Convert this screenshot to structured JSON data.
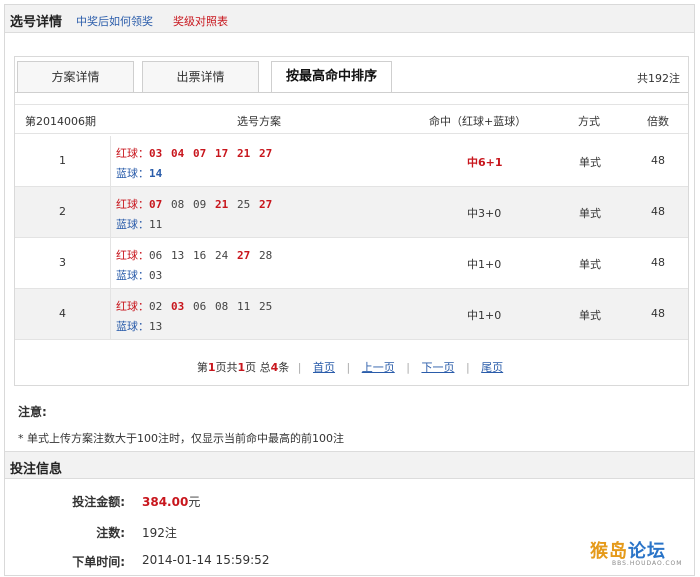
{
  "header": {
    "title": "选号详情",
    "link1": "中奖后如何领奖",
    "link2": "奖级对照表"
  },
  "tabs": [
    {
      "label": "方案详情"
    },
    {
      "label": "出票详情"
    },
    {
      "label": "按最高命中排序"
    }
  ],
  "total": "共192注",
  "table": {
    "headers": [
      "第2014006期",
      "选号方案",
      "命中（红球+蓝球）",
      "方式",
      "倍数"
    ],
    "red_label": "红球：",
    "blue_label": "蓝球：",
    "rows": [
      {
        "idx": "1",
        "red": [
          "03",
          "04",
          "07",
          "17",
          "21",
          "27"
        ],
        "red_hit": [
          true,
          true,
          true,
          true,
          true,
          true
        ],
        "blue": [
          "14"
        ],
        "blue_hit": [
          true
        ],
        "hit": "中6+1",
        "hit_main": true,
        "mode": "单式",
        "times": "48"
      },
      {
        "idx": "2",
        "red": [
          "07",
          "08",
          "09",
          "21",
          "25",
          "27"
        ],
        "red_hit": [
          true,
          false,
          false,
          true,
          false,
          true
        ],
        "blue": [
          "11"
        ],
        "blue_hit": [
          false
        ],
        "hit": "中3+0",
        "hit_main": false,
        "mode": "单式",
        "times": "48"
      },
      {
        "idx": "3",
        "red": [
          "06",
          "13",
          "16",
          "24",
          "27",
          "28"
        ],
        "red_hit": [
          false,
          false,
          false,
          false,
          true,
          false
        ],
        "blue": [
          "03"
        ],
        "blue_hit": [
          false
        ],
        "hit": "中1+0",
        "hit_main": false,
        "mode": "单式",
        "times": "48"
      },
      {
        "idx": "4",
        "red": [
          "02",
          "03",
          "06",
          "08",
          "11",
          "25"
        ],
        "red_hit": [
          false,
          true,
          false,
          false,
          false,
          false
        ],
        "blue": [
          "13"
        ],
        "blue_hit": [
          false
        ],
        "hit": "中1+0",
        "hit_main": false,
        "mode": "单式",
        "times": "48"
      }
    ]
  },
  "pager": {
    "prefix": "第",
    "page": "1",
    "mid": "页共",
    "pages": "1",
    "mid2": "页 总",
    "count": "4",
    "suffix": "条",
    "first": "首页",
    "prev": "上一页",
    "next": "下一页",
    "last": "尾页"
  },
  "notes": {
    "title": "注意:",
    "line": "* 单式上传方案注数大于100注时，仅显示当前命中最高的前100注"
  },
  "bet": {
    "title": "投注信息",
    "amount_label": "投注金额:",
    "amount": "384.00",
    "amount_unit": "元",
    "count_label": "注数:",
    "count": "192注",
    "time_label": "下单时间:",
    "time": "2014-01-14 15:59:52"
  },
  "watermark": {
    "text_a": "猴岛",
    "text_b": "论坛",
    "sub": "BBS.HOUDAO.COM"
  },
  "colors": {
    "red": "#c8161d",
    "blue": "#2a5caa"
  }
}
